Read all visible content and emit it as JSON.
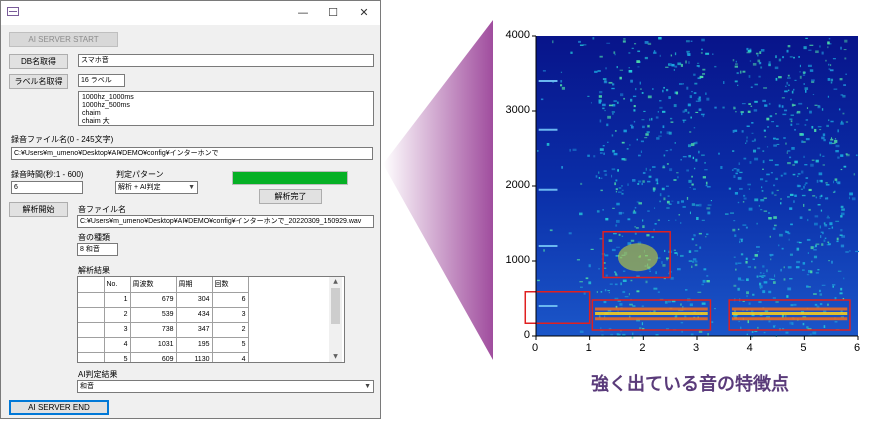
{
  "window": {
    "minimize_glyph": "—",
    "maximize_glyph": "☐",
    "close_glyph": "✕",
    "ai_server_start": "AI SERVER START",
    "db_button": "DB名取得",
    "db_value": "スマホ音",
    "label_button": "ラベル名取得",
    "label_value": "16 ラベル",
    "label_list": [
      "1000hz_1000ms",
      "1000hz_500ms",
      "chaim",
      "chaim 大"
    ],
    "filename_label": "録音ファイル名(0 - 245文字)",
    "filename_value": "C:¥Users¥m_umeno¥Desktop¥AI¥DEMO¥config¥インターホンで",
    "rec_time_label": "録音時間(秒:1 - 600)",
    "rec_time_value": "6",
    "judge_pattern_label": "判定パターン",
    "judge_pattern_value": "解析 + AI判定",
    "progress_percent": 100,
    "analysis_done_button": "解析完了",
    "analyze_start_button": "解析開始",
    "sound_file_label": "音ファイル名",
    "sound_file_value": "C:¥Users¥m_umeno¥Desktop¥AI¥DEMO¥config¥インターホンで_20220309_150929.wav",
    "sound_type_label": "音の種類",
    "sound_type_value": "8 和音",
    "result_label": "解析結果",
    "table": {
      "headers": [
        "No.",
        "周波数",
        "周期",
        "回数"
      ],
      "rows": [
        [
          "1",
          "679",
          "304",
          "6"
        ],
        [
          "2",
          "539",
          "434",
          "3"
        ],
        [
          "3",
          "738",
          "347",
          "2"
        ],
        [
          "4",
          "1031",
          "195",
          "5"
        ],
        [
          "5",
          "609",
          "1130",
          "4"
        ]
      ]
    },
    "ai_result_label": "AI判定結果",
    "ai_result_value": "和音",
    "ai_server_end": "AI SERVER END"
  },
  "caption": "強く出ている音の特徴点",
  "chart_data": {
    "type": "heatmap",
    "title": "",
    "xlabel": "",
    "ylabel": "",
    "xlim": [
      0,
      6
    ],
    "ylim": [
      0,
      4000
    ],
    "x_ticks": [
      "0",
      "1",
      "2",
      "3",
      "4",
      "5",
      "6"
    ],
    "y_ticks": [
      "0",
      "1000",
      "2000",
      "3000",
      "4000"
    ],
    "highlight_boxes": [
      {
        "x": [
          -0.2,
          1.0
        ],
        "y": [
          170,
          590
        ]
      },
      {
        "x": [
          1.05,
          3.25
        ],
        "y": [
          80,
          480
        ]
      },
      {
        "x": [
          1.25,
          2.5
        ],
        "y": [
          780,
          1390
        ]
      },
      {
        "x": [
          3.6,
          5.85
        ],
        "y": [
          80,
          480
        ]
      }
    ],
    "highlight_color": "#e02020"
  }
}
